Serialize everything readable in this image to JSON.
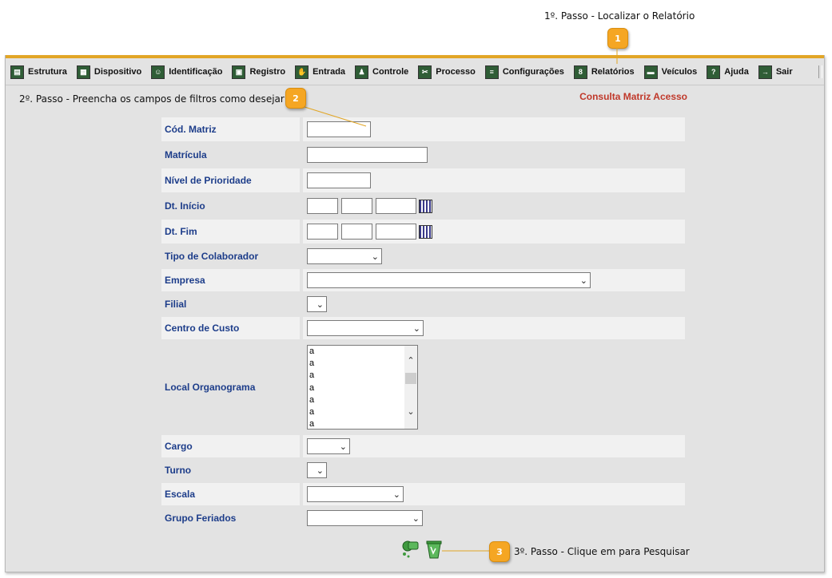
{
  "annotations": {
    "step1": {
      "badge": "1",
      "text": "1º. Passo - Localizar o Relatório"
    },
    "step2": {
      "badge": "2",
      "text": "2º. Passo - Preencha os campos de filtros como desejar"
    },
    "step3": {
      "badge": "3",
      "text": "3º. Passo - Clique em para Pesquisar"
    }
  },
  "menu": {
    "items": [
      {
        "label": "Estrutura",
        "icon": "structure-icon"
      },
      {
        "label": "Dispositivo",
        "icon": "device-icon"
      },
      {
        "label": "Identificação",
        "icon": "identification-icon"
      },
      {
        "label": "Registro",
        "icon": "registry-icon"
      },
      {
        "label": "Entrada",
        "icon": "entry-icon"
      },
      {
        "label": "Controle",
        "icon": "control-icon"
      },
      {
        "label": "Processo",
        "icon": "process-icon"
      },
      {
        "label": "Configurações",
        "icon": "settings-icon"
      },
      {
        "label": "Relatórios",
        "icon": "reports-icon"
      },
      {
        "label": "Veículos",
        "icon": "vehicle-icon"
      },
      {
        "label": "Ajuda",
        "icon": "help-icon"
      },
      {
        "label": "Sair",
        "icon": "exit-icon"
      }
    ]
  },
  "page": {
    "title": "Consulta Matriz Acesso"
  },
  "form": {
    "cod_matriz": {
      "label": "Cód. Matriz",
      "value": ""
    },
    "matricula": {
      "label": "Matrícula",
      "value": ""
    },
    "nivel_prioridade": {
      "label": "Nível de Prioridade",
      "value": ""
    },
    "dt_inicio": {
      "label": "Dt. Início",
      "day": "",
      "month": "",
      "year": ""
    },
    "dt_fim": {
      "label": "Dt. Fim",
      "day": "",
      "month": "",
      "year": ""
    },
    "tipo_colaborador": {
      "label": "Tipo de Colaborador",
      "selected": ""
    },
    "empresa": {
      "label": "Empresa",
      "selected": ""
    },
    "filial": {
      "label": "Filial",
      "selected": ""
    },
    "centro_custo": {
      "label": "Centro de Custo",
      "selected": ""
    },
    "local_organograma": {
      "label": "Local Organograma",
      "options": [
        "a",
        "a",
        "a",
        "a",
        "a",
        "a",
        "a"
      ]
    },
    "cargo": {
      "label": "Cargo",
      "selected": ""
    },
    "turno": {
      "label": "Turno",
      "selected": ""
    },
    "escala": {
      "label": "Escala",
      "selected": ""
    },
    "grupo_feriados": {
      "label": "Grupo Feriados",
      "selected": ""
    }
  },
  "actions": {
    "search_icon": "binoculars-search-icon",
    "clear_icon": "clear-filter-icon"
  },
  "colors": {
    "accent": "#e2a626",
    "title": "#c0392b",
    "label": "#1d3d8a",
    "badge": "#f5a623"
  }
}
